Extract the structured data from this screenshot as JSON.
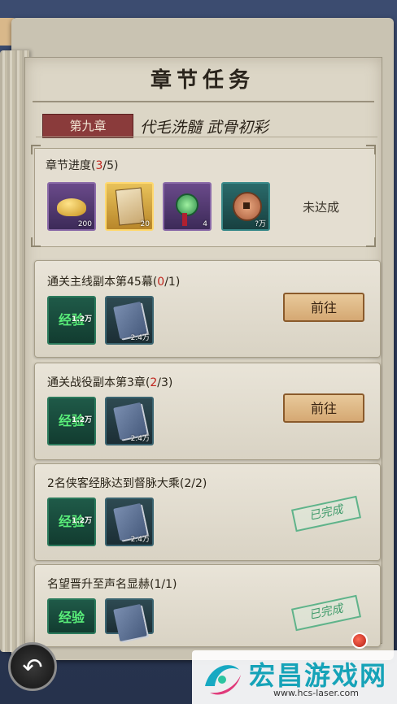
{
  "header": {
    "title": "章节任务"
  },
  "chapter": {
    "badge": "第九章",
    "name": "代毛洗髓 武骨初彩"
  },
  "progress": {
    "label_prefix": "章节进度(",
    "current": "3",
    "label_suffix": "/5)",
    "rewards": [
      {
        "icon": "gold-ingot-icon",
        "count": "200"
      },
      {
        "icon": "scroll-card-icon",
        "count": "20"
      },
      {
        "icon": "jade-pendant-icon",
        "count": "4"
      },
      {
        "icon": "copper-coin-icon",
        "count": "?万"
      }
    ],
    "status": "未达成"
  },
  "tasks": [
    {
      "title_prefix": "通关主线副本第45幕(",
      "current": "0",
      "title_suffix": "/1)",
      "rewards": [
        {
          "label": "经验",
          "count": "1.2万"
        },
        {
          "icon": "skill-book-icon",
          "count": "2.4万"
        }
      ],
      "action": "前往",
      "done": false
    },
    {
      "title_prefix": "通关战役副本第3章(",
      "current": "2",
      "title_suffix": "/3)",
      "rewards": [
        {
          "label": "经验",
          "count": "1.2万"
        },
        {
          "icon": "skill-book-icon",
          "count": "2.4万"
        }
      ],
      "action": "前往",
      "done": false
    },
    {
      "title_prefix": "2名侠客经脉达到督脉大乘(2/2)",
      "current": "",
      "title_suffix": "",
      "rewards": [
        {
          "label": "经验",
          "count": "1.2万"
        },
        {
          "icon": "skill-book-icon",
          "count": "2.4万"
        }
      ],
      "stamp": "已完成",
      "done": true
    },
    {
      "title_prefix": "名望晋升至声名显赫(1/1)",
      "current": "",
      "title_suffix": "",
      "rewards": [
        {
          "label": "经验",
          "count": ""
        },
        {
          "icon": "skill-book-icon",
          "count": ""
        }
      ],
      "stamp": "已完成",
      "done": true
    }
  ],
  "watermark": {
    "text": "宏昌游戏网",
    "url": "www.hcs-laser.com"
  },
  "colors": {
    "accent_red": "#c0261e",
    "button": "#d5a873",
    "done_green": "#3e9a6a"
  }
}
